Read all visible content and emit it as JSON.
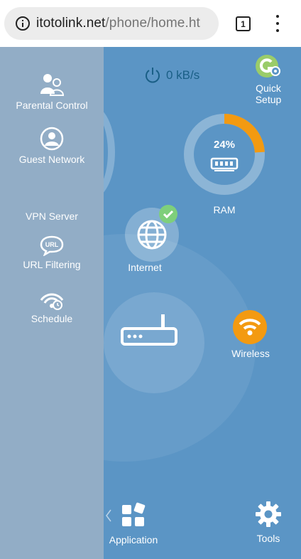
{
  "browser": {
    "url_host": "itotolink.net",
    "url_path": "/phone/home.ht",
    "tab_count": "1"
  },
  "status": {
    "speed": "0 kB/s"
  },
  "quick_setup": {
    "label_line1": "Quick",
    "label_line2": "Setup"
  },
  "ram": {
    "percent": "24%",
    "usage_fraction": 0.24,
    "label": "RAM"
  },
  "internet": {
    "label": "Internet"
  },
  "wireless": {
    "label": "Wireless"
  },
  "bottom": {
    "application_label": "Application",
    "tools_label": "Tools"
  },
  "sidebar": {
    "items": [
      {
        "label": "Parental Control",
        "icon": "parental-control-icon"
      },
      {
        "label": "Guest Network",
        "icon": "guest-network-icon"
      },
      {
        "label": "VPN Server",
        "icon": ""
      },
      {
        "label": "URL Filtering",
        "icon": "url-filtering-icon"
      },
      {
        "label": "Schedule",
        "icon": "schedule-icon"
      }
    ]
  },
  "colors": {
    "background": "#5b95c5",
    "sidebar": "#92adc6",
    "accent_orange": "#f39a11",
    "accent_green": "#7ecf7b",
    "speed_text": "#1a5f86"
  }
}
